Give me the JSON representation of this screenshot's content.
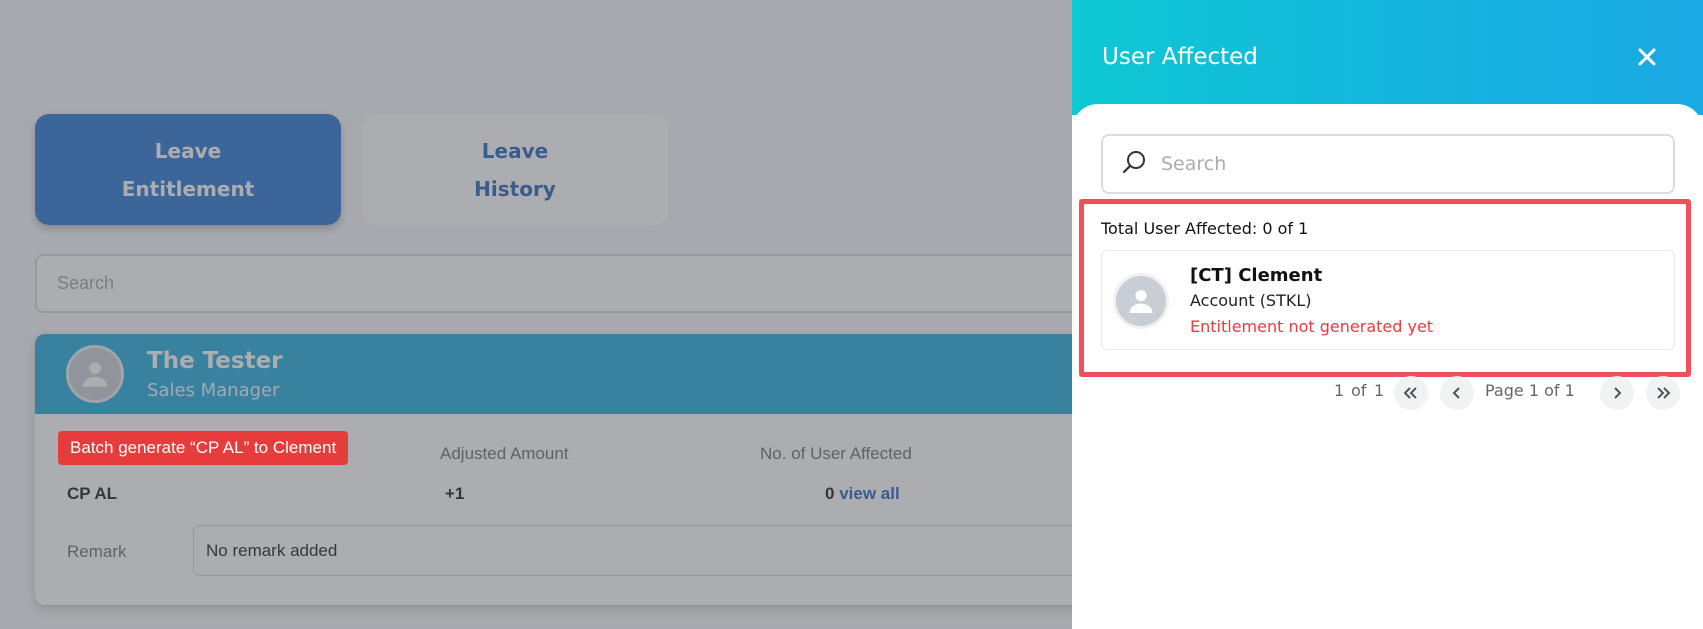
{
  "tabs": [
    {
      "line1": "Leave",
      "line2": "Entitlement",
      "active": true
    },
    {
      "line1": "Leave",
      "line2": "History",
      "active": false
    }
  ],
  "page_search": {
    "placeholder": "Search"
  },
  "employee_card": {
    "name": "The Tester",
    "role": "Sales Manager",
    "annotation": "Batch generate “CP AL” to Clement",
    "adjusted_amount_label": "Adjusted Amount",
    "users_affected_label": "No. of User Affected",
    "leave_type": "CP AL",
    "adjusted_amount": "+1",
    "users_affected_count": "0",
    "view_all_label": "view all",
    "remark_label": "Remark",
    "remark_value": "No remark added"
  },
  "panel": {
    "title": "User Affected",
    "search_placeholder": "Search",
    "total_text": "Total User Affected: 0 of 1",
    "users": [
      {
        "name": "[CT] Clement",
        "department": "Account (STKL)",
        "status": "Entitlement not generated yet"
      }
    ],
    "pagination": {
      "range": "1",
      "of_label": "of",
      "total": "1",
      "page_text": "Page 1 of 1"
    }
  },
  "colors": {
    "primary": "#1f6fd0",
    "header_gradient_start": "#0ec8d3",
    "header_gradient_end": "#1aa9e3",
    "card_header": "#18a9dc",
    "alert_red": "#ee3a3a",
    "highlight_red": "#f0505a"
  },
  "icons": {
    "close": "close-icon",
    "search": "search-icon",
    "avatar": "user-avatar-icon",
    "first_page": "double-chevron-left-icon",
    "prev_page": "chevron-left-icon",
    "next_page": "chevron-right-icon",
    "last_page": "double-chevron-right-icon"
  }
}
